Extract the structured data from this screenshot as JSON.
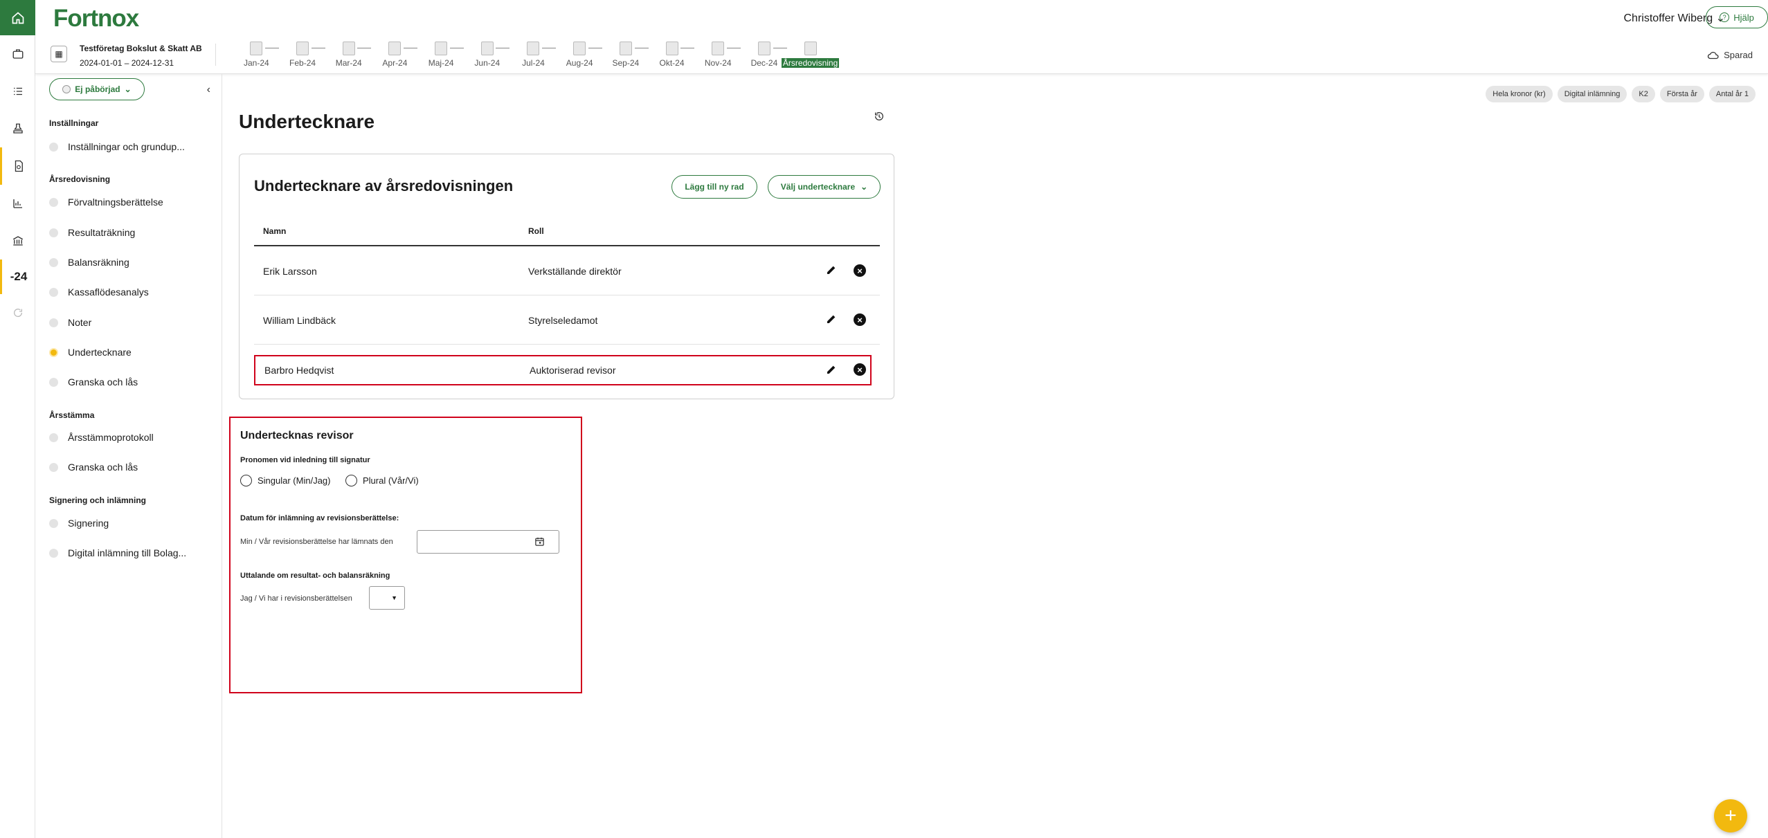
{
  "app": {
    "logo": "Fortnox",
    "user": "Christoffer Wiberg",
    "help": "Hjälp",
    "saved": "Sparad"
  },
  "company": {
    "name": "Testföretag Bokslut & Skatt AB",
    "period": "2024-01-01 – 2024-12-31"
  },
  "months": [
    "Jan-24",
    "Feb-24",
    "Mar-24",
    "Apr-24",
    "Maj-24",
    "Jun-24",
    "Jul-24",
    "Aug-24",
    "Sep-24",
    "Okt-24",
    "Nov-24",
    "Dec-24",
    "Årsredovisning"
  ],
  "rail": {
    "year_label": "-24"
  },
  "sidebar": {
    "status": "Ej påbörjad",
    "sections": {
      "s1": "Inställningar",
      "s2": "Årsredovisning",
      "s3": "Årsstämma",
      "s4": "Signering och inlämning"
    },
    "items": {
      "i1": "Inställningar och grundup...",
      "i2": "Förvaltningsberättelse",
      "i3": "Resultaträkning",
      "i4": "Balansräkning",
      "i5": "Kassaflödesanalys",
      "i6": "Noter",
      "i7": "Undertecknare",
      "i8": "Granska och lås",
      "i9": "Årsstämmoprotokoll",
      "i10": "Granska och lås",
      "i11": "Signering",
      "i12": "Digital inlämning till Bolag..."
    }
  },
  "chips": [
    "Hela kronor (kr)",
    "Digital inlämning",
    "K2",
    "Första år",
    "Antal år 1"
  ],
  "page": {
    "title": "Undertecknare"
  },
  "card": {
    "title": "Undertecknare av årsredovisningen",
    "add_row": "Lägg till ny rad",
    "choose": "Välj undertecknare",
    "col_name": "Namn",
    "col_role": "Roll",
    "rows": [
      {
        "name": "Erik Larsson",
        "role": "Verkställande direktör"
      },
      {
        "name": "William Lindbäck",
        "role": "Styrelseledamot"
      },
      {
        "name": "Barbro Hedqvist",
        "role": "Auktoriserad revisor"
      }
    ]
  },
  "revisor": {
    "title": "Undertecknas revisor",
    "pronoun_label": "Pronomen vid inledning till signatur",
    "singular": "Singular (Min/Jag)",
    "plural": "Plural (Vår/Vi)",
    "date_label": "Datum för inlämning av revisionsberättelse:",
    "date_text": "Min / Vår revisionsberättelse har lämnats den",
    "statement_label": "Uttalande om resultat- och balansräkning",
    "statement_text": "Jag / Vi har i revisionsberättelsen"
  },
  "colors": {
    "brand": "#2d7a3e",
    "accent": "#f2b90f",
    "highlight": "#d0021b"
  }
}
